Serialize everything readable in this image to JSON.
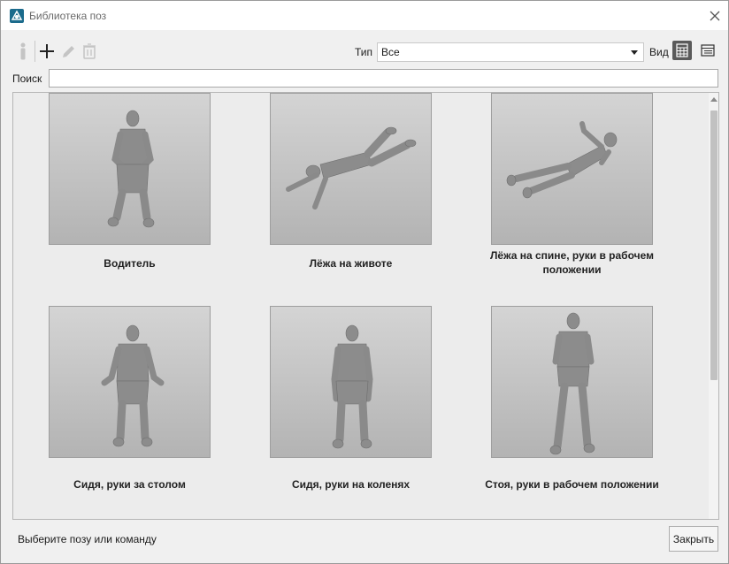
{
  "window": {
    "title": "Библиотека поз"
  },
  "toolbar": {
    "buttons": [
      {
        "icon": "figure-icon",
        "enabled": false
      },
      {
        "icon": "plus-icon",
        "enabled": true
      },
      {
        "icon": "pencil-icon",
        "enabled": false
      },
      {
        "icon": "trash-icon",
        "enabled": false
      }
    ],
    "type_label": "Тип",
    "type_value": "Все",
    "view_label": "Вид",
    "view_options": [
      {
        "icon": "grid-view-icon",
        "selected": true
      },
      {
        "icon": "list-view-icon",
        "selected": false
      }
    ]
  },
  "search": {
    "label": "Поиск",
    "value": ""
  },
  "poses": [
    {
      "name": "Водитель",
      "pose": "sitting-driver"
    },
    {
      "name": "Лёжа на животе",
      "pose": "lying-prone"
    },
    {
      "name": "Лёжа на спине, руки в рабочем положении",
      "pose": "lying-supine"
    },
    {
      "name": "Сидя, руки за столом",
      "pose": "sitting-table"
    },
    {
      "name": "Сидя, руки на коленях",
      "pose": "sitting-knees"
    },
    {
      "name": "Стоя, руки в рабочем положении",
      "pose": "standing"
    }
  ],
  "status": {
    "text": "Выберите позу или команду"
  },
  "buttons": {
    "close_label": "Закрыть"
  },
  "colors": {
    "accent": "#1b6b8c",
    "active_view": "#5a5a5a"
  }
}
